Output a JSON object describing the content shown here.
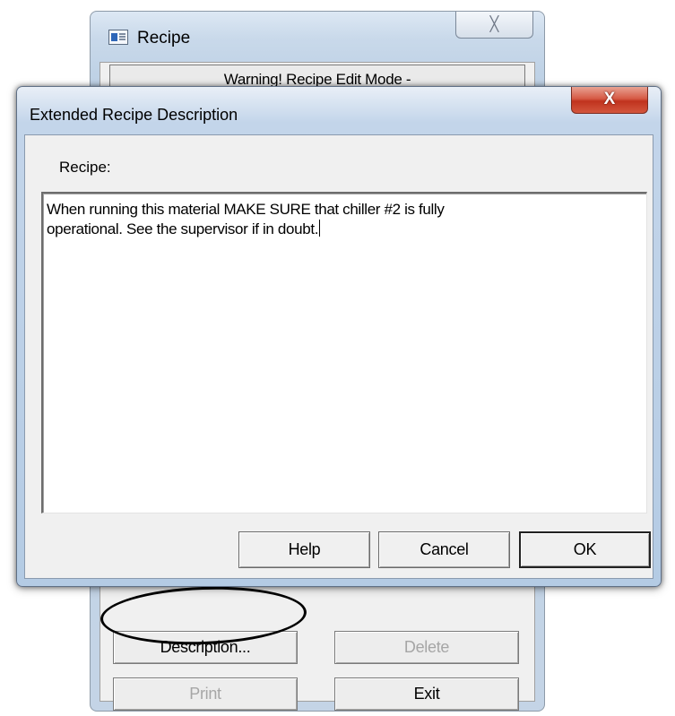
{
  "background_window": {
    "title": "Recipe",
    "icon": "app-icon",
    "close_glyph": "╳",
    "warning_text": "Warning! Recipe Edit Mode -",
    "buttons": {
      "description": "Description...",
      "delete": "Delete",
      "print": "Print",
      "exit": "Exit"
    }
  },
  "dialog": {
    "title": "Extended Recipe Description",
    "close_glyph": "X",
    "recipe_label": "Recipe:",
    "description_text": "When running this material MAKE SURE that chiller #2 is fully\noperational. See the supervisor if in doubt.",
    "buttons": {
      "help": "Help",
      "cancel": "Cancel",
      "ok": "OK"
    }
  },
  "colors": {
    "titlebar": "#c3d5ea",
    "close_button": "#c0331e",
    "client": "#f0f0f0",
    "disabled_text": "#a6a6a6"
  }
}
